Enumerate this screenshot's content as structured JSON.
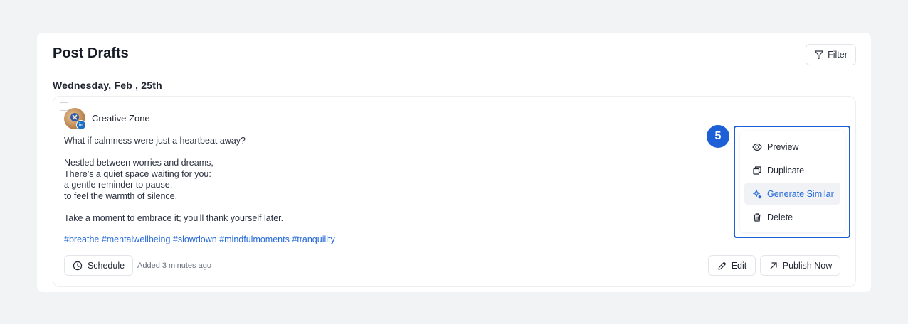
{
  "page": {
    "title": "Post Drafts",
    "filter_label": "Filter",
    "date_heading": "Wednesday, Feb , 25th"
  },
  "post": {
    "account_name": "Creative Zone",
    "platform_badge": "in",
    "lines": [
      "What if calmness were just a heartbeat away?",
      "",
      "Nestled between worries and dreams,",
      "There’s a quiet space waiting for you:",
      "a gentle reminder to pause,",
      "to feel the warmth of silence.",
      "",
      "Take a moment to embrace it; you'll thank yourself later."
    ],
    "hashtags": "#breathe #mentalwellbeing #slowdown #mindfulmoments #tranquility",
    "schedule_label": "Schedule",
    "added_text": "Added 3 minutes ago",
    "edit_label": "Edit",
    "publish_label": "Publish Now"
  },
  "menu": {
    "items": [
      {
        "label": "Preview",
        "icon": "eye-icon"
      },
      {
        "label": "Duplicate",
        "icon": "copy-icon"
      },
      {
        "label": "Generate Similar",
        "icon": "sparkle-icon",
        "active": true
      },
      {
        "label": "Delete",
        "icon": "trash-icon"
      }
    ]
  },
  "annotation": {
    "step_number": "5",
    "highlight_color": "#1c5fd6"
  },
  "colors": {
    "accent": "#2468d8",
    "background": "#f2f3f5",
    "linkedin": "#1d6fc2"
  }
}
